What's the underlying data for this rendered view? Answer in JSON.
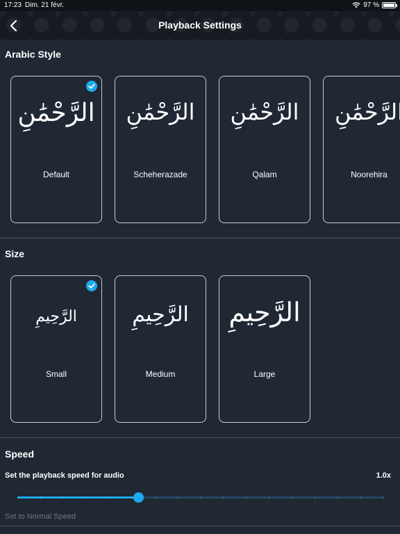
{
  "status_bar": {
    "time": "17:23",
    "date": "Dim. 21 févr.",
    "battery": "97 %",
    "battery_level": 0.97,
    "wifi_icon": "wifi-icon"
  },
  "header": {
    "title": "Playback Settings",
    "back_icon": "chevron-left-icon"
  },
  "arabic_style": {
    "title": "Arabic Style",
    "selected": "Default",
    "options": [
      {
        "label": "Default",
        "glyph": "الرَّحْمَٰنِ"
      },
      {
        "label": "Scheherazade",
        "glyph": "الرَّحْمَٰنِ"
      },
      {
        "label": "Qalam",
        "glyph": "الرَّحْمَٰنِ"
      },
      {
        "label": "Noorehira",
        "glyph": "الرَّحْمَٰنِ"
      }
    ]
  },
  "size": {
    "title": "Size",
    "selected": "Small",
    "options": [
      {
        "label": "Small",
        "glyph": "الرَّحِيمِ"
      },
      {
        "label": "Medium",
        "glyph": "الرَّحِيمِ"
      },
      {
        "label": "Large",
        "glyph": "الرَّحِيمِ"
      }
    ]
  },
  "speed": {
    "title": "Speed",
    "description": "Set the playback speed for audio",
    "value_label": "1.0x",
    "slider_fraction": 0.33,
    "tick_count": 16,
    "reset_label": "Set to Normal Speed"
  },
  "colors": {
    "background": "#1f2833",
    "accent": "#1fa9ee",
    "card_border": "#c9cdd2",
    "divider": "#4a545e",
    "muted_text": "#6f7882"
  }
}
